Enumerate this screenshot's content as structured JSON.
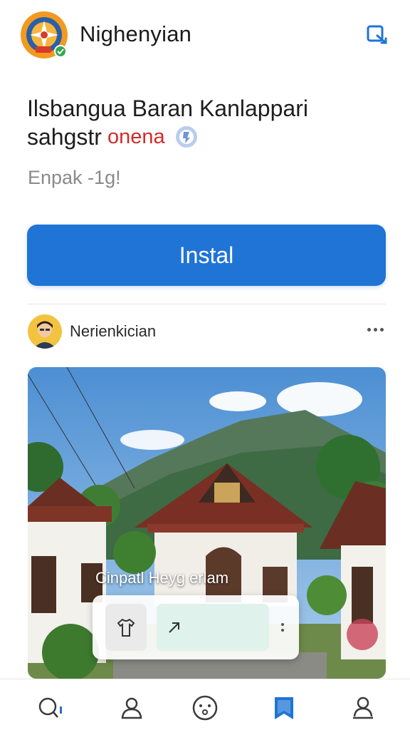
{
  "header": {
    "app_name": "Nighenyian",
    "logo_icon": "compass-logo-icon",
    "action_icon": "share-icon",
    "accent_color": "#1f74d6"
  },
  "intro": {
    "headline_line1": "Ilsbangua Baran Kanlappari",
    "headline_line2_start": "sahgstr",
    "headline_line2_accent": "onena",
    "badge_icon": "verified-badge-icon",
    "subline": "Enpak -1g!",
    "accent_text_color": "#d22a2a"
  },
  "install_button": {
    "label": "Instal",
    "color": "#1f74d6"
  },
  "post": {
    "author": "Nerienkician",
    "more_icon": "more-options-icon",
    "overlay_caption": "Cinpatl Heyg erlam",
    "overlay_button_icon": "shirt-icon",
    "overlay_input_icon": "arrow-up-right-icon"
  },
  "bottom_nav": {
    "items": [
      {
        "icon": "search-icon"
      },
      {
        "icon": "profile-icon"
      },
      {
        "icon": "emoji-icon"
      },
      {
        "icon": "bookmark-icon",
        "active": true
      },
      {
        "icon": "account-icon"
      }
    ],
    "active_color": "#1f74d6"
  }
}
